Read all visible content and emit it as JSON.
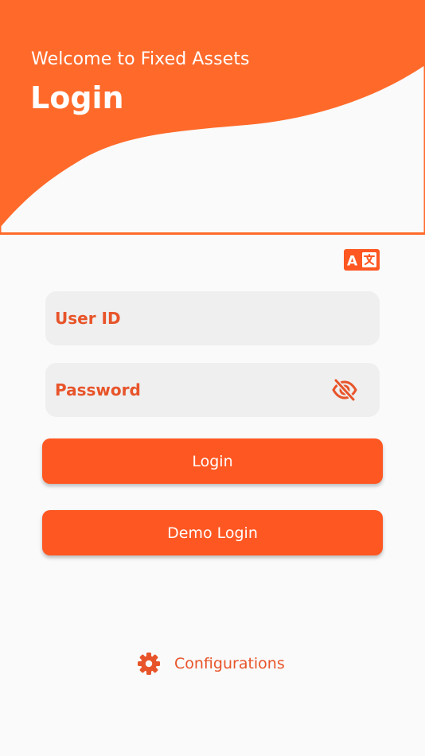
{
  "header": {
    "welcome_text": "Welcome to Fixed Assets",
    "title": "Login"
  },
  "language": {
    "icon": "translate-icon"
  },
  "form": {
    "user_id_placeholder": "User ID",
    "password_placeholder": "Password",
    "password_visibility_icon": "eye-off-icon"
  },
  "actions": {
    "login_label": "Login",
    "demo_login_label": "Demo Login"
  },
  "footer": {
    "config_label": "Configurations",
    "config_icon": "gear-icon"
  },
  "colors": {
    "accent": "#ff5722",
    "header": "#ff6a2a",
    "field_text": "#e8542a",
    "field_bg": "#efefef",
    "background": "#fafafa"
  }
}
